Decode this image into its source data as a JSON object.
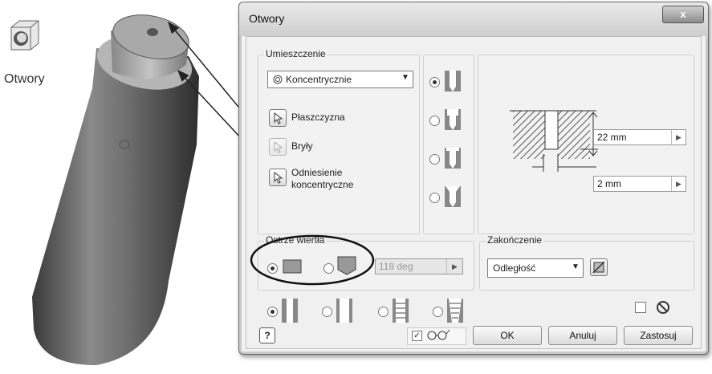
{
  "ribbon": {
    "tool_label": "Otwory"
  },
  "dialog": {
    "title": "Otwory",
    "close_label": "x",
    "placement": {
      "group_label": "Umieszczenie",
      "mode_selected": "Koncentrycznie",
      "selectors": [
        {
          "label": "Płaszczyzna"
        },
        {
          "label": "Bryły"
        },
        {
          "label": "Odniesienie koncentryczne"
        }
      ]
    },
    "preview": {
      "depth_value": "22 mm",
      "diameter_value": "2 mm"
    },
    "drill_point": {
      "group_label": "Ostrze wiertła",
      "angle_value": "118 deg"
    },
    "termination": {
      "group_label": "Zakończenie",
      "selected": "Odległość"
    },
    "buttons": {
      "ok": "OK",
      "cancel": "Anuluj",
      "apply": "Zastosuj",
      "help": "?"
    }
  }
}
